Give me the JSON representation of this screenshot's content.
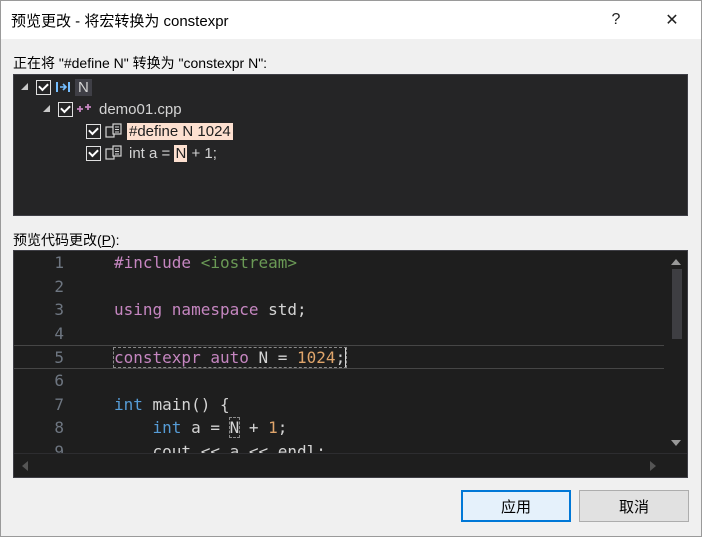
{
  "window": {
    "title": "预览更改 - 将宏转换为 constexpr",
    "help_glyph": "?",
    "close_glyph": "✕"
  },
  "tree_section": {
    "label": "正在将 \"#define N\" 转换为 \"constexpr N\":",
    "root": {
      "label": "N",
      "checked": true,
      "icon": "symbol-arrow-icon"
    },
    "file": {
      "label": "demo01.cpp",
      "checked": true,
      "icon": "cpp-file-icon"
    },
    "changes": [
      {
        "label": "#define N 1024",
        "checked": true,
        "icon": "code-change-icon"
      },
      {
        "label_before": "int a = ",
        "label_highlight": "N",
        "label_after": " + 1;",
        "checked": true,
        "icon": "code-change-icon"
      }
    ]
  },
  "preview_section": {
    "label_before": "预览代码更改(",
    "label_accel": "P",
    "label_after": "):"
  },
  "code_lines": [
    {
      "n": "1",
      "parts": [
        [
          "inc",
          "#include "
        ],
        [
          "str",
          "<iostream>"
        ]
      ]
    },
    {
      "n": "2",
      "parts": []
    },
    {
      "n": "3",
      "parts": [
        [
          "kw",
          "using "
        ],
        [
          "kw",
          "namespace "
        ],
        [
          "plain",
          "std;"
        ]
      ]
    },
    {
      "n": "4",
      "parts": []
    },
    {
      "n": "5",
      "parts": [
        [
          "kw",
          "constexpr "
        ],
        [
          "kw",
          "auto "
        ],
        [
          "plain",
          "N = "
        ],
        [
          "num",
          "1024"
        ],
        [
          "plain",
          ";"
        ]
      ]
    },
    {
      "n": "6",
      "parts": []
    },
    {
      "n": "7",
      "parts": [
        [
          "kw2",
          "int "
        ],
        [
          "plain",
          "main() {"
        ]
      ]
    },
    {
      "n": "8",
      "parts": [
        [
          "plain",
          "    "
        ],
        [
          "kw2",
          "int "
        ],
        [
          "plain",
          "a = "
        ],
        [
          "plain",
          "N"
        ],
        [
          "plain",
          " + "
        ],
        [
          "num",
          "1"
        ],
        [
          "plain",
          ";"
        ]
      ]
    },
    {
      "n": "9",
      "parts": [
        [
          "plain",
          "    cout << a << endl;"
        ]
      ]
    }
  ],
  "buttons": {
    "apply": "应用",
    "cancel": "取消"
  },
  "colors": {
    "panel_bg": "#252526",
    "editor_bg": "#1e1e1e",
    "keyword": "#c586c0",
    "type_keyword": "#569cd6",
    "string": "#6a9955",
    "number": "#e0a56b",
    "highlight": "#fde0d0",
    "accent": "#0078d7"
  }
}
